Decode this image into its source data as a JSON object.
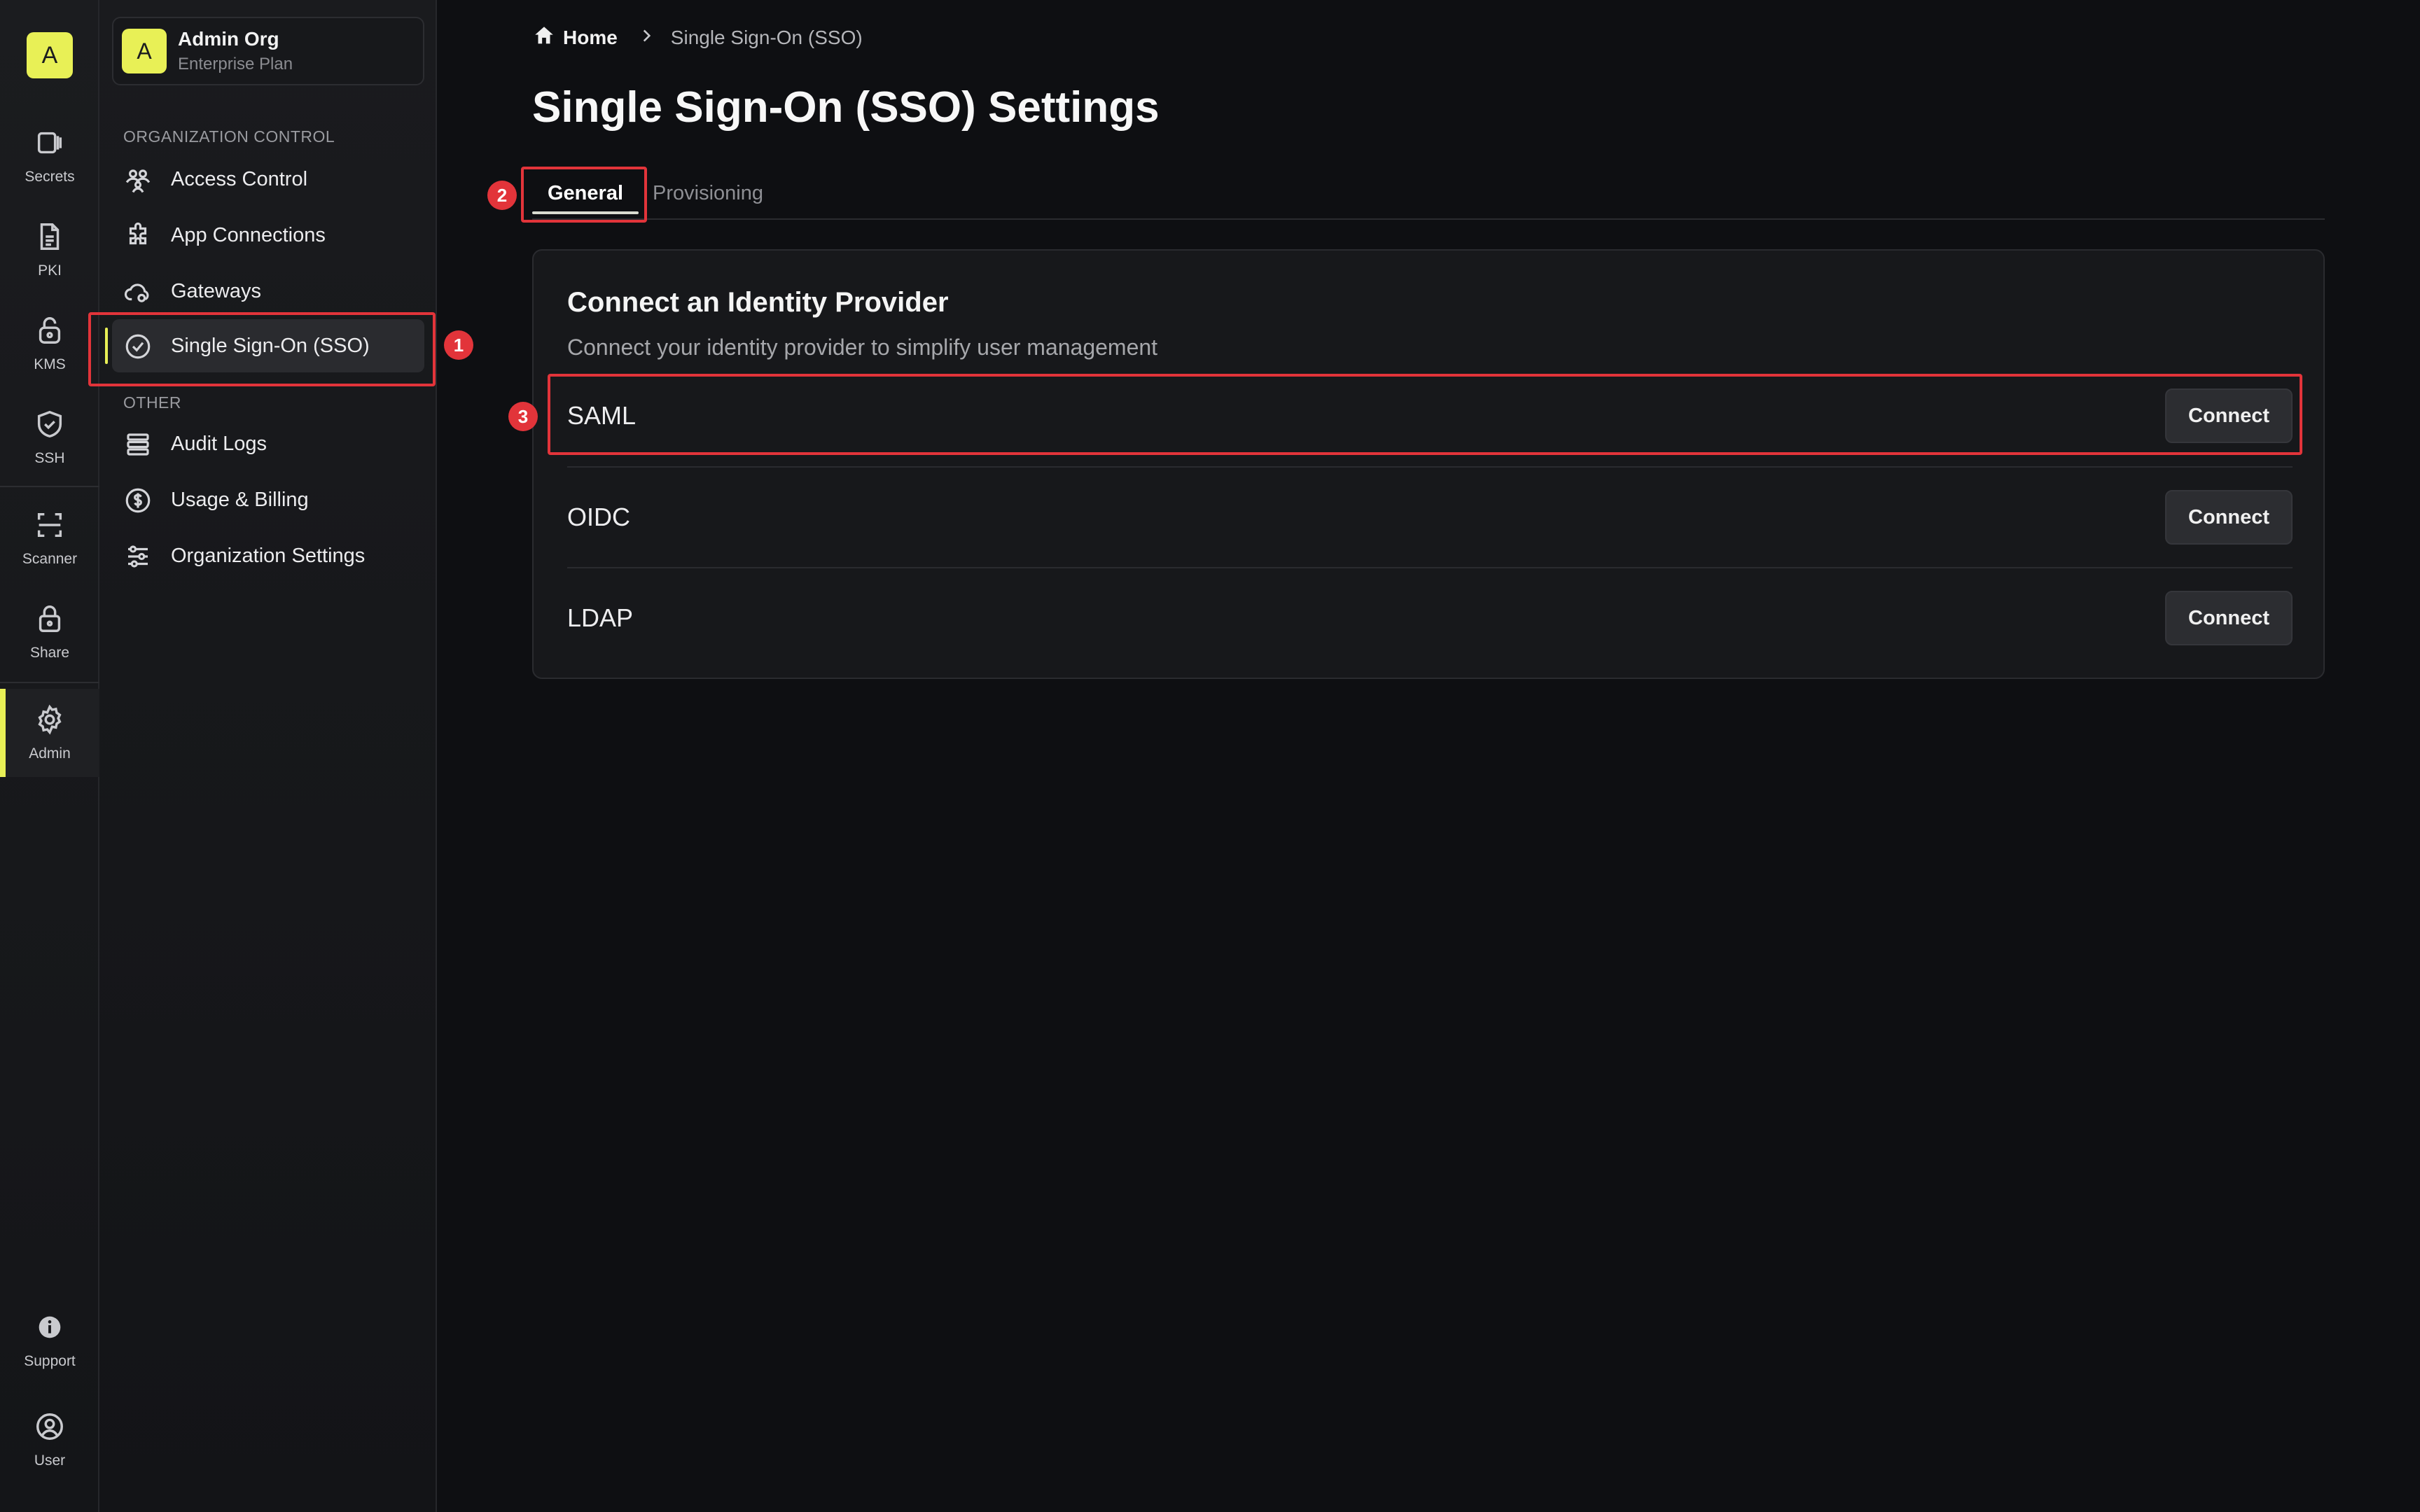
{
  "rail": {
    "logo_letter": "A",
    "items": [
      {
        "label": "Secrets"
      },
      {
        "label": "PKI"
      },
      {
        "label": "KMS"
      },
      {
        "label": "SSH"
      },
      {
        "label": "Scanner"
      },
      {
        "label": "Share"
      },
      {
        "label": "Admin"
      },
      {
        "label": "Support"
      },
      {
        "label": "User"
      }
    ],
    "active": "Admin",
    "accent_color": "#e8f056"
  },
  "org": {
    "avatar_letter": "A",
    "name": "Admin Org",
    "plan": "Enterprise Plan"
  },
  "sidebar": {
    "section_org": "ORGANIZATION CONTROL",
    "org_items": [
      {
        "label": "Access Control",
        "icon": "users-icon"
      },
      {
        "label": "App Connections",
        "icon": "puzzle-icon"
      },
      {
        "label": "Gateways",
        "icon": "cloud-gear-icon"
      },
      {
        "label": "Single Sign-On (SSO)",
        "icon": "check-circle-icon"
      }
    ],
    "section_other": "OTHER",
    "other_items": [
      {
        "label": "Audit Logs",
        "icon": "list-icon"
      },
      {
        "label": "Usage & Billing",
        "icon": "dollar-circle-icon"
      },
      {
        "label": "Organization Settings",
        "icon": "sliders-icon"
      }
    ],
    "active": "Single Sign-On (SSO)"
  },
  "breadcrumb": {
    "home": "Home",
    "current": "Single Sign-On (SSO)"
  },
  "page": {
    "title": "Single Sign-On (SSO) Settings"
  },
  "tabs": [
    {
      "label": "General",
      "active": true
    },
    {
      "label": "Provisioning",
      "active": false
    }
  ],
  "card": {
    "title": "Connect an Identity Provider",
    "subtitle": "Connect your identity provider to simplify user management",
    "providers": [
      {
        "name": "SAML",
        "button": "Connect"
      },
      {
        "name": "OIDC",
        "button": "Connect"
      },
      {
        "name": "LDAP",
        "button": "Connect"
      }
    ]
  },
  "annotations": {
    "color": "#e2343a",
    "badges": [
      "1",
      "2",
      "3"
    ]
  }
}
